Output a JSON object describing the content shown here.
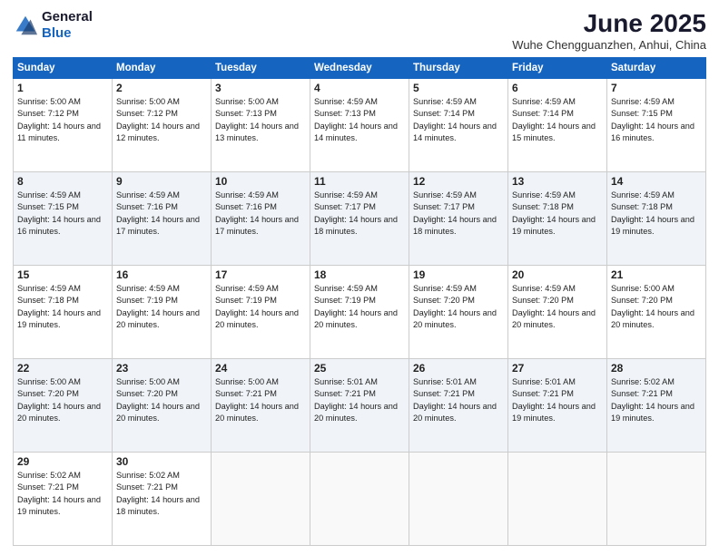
{
  "header": {
    "logo_general": "General",
    "logo_blue": "Blue",
    "month_title": "June 2025",
    "location": "Wuhe Chengguanzhen, Anhui, China"
  },
  "days_of_week": [
    "Sunday",
    "Monday",
    "Tuesday",
    "Wednesday",
    "Thursday",
    "Friday",
    "Saturday"
  ],
  "weeks": [
    [
      {
        "day": "1",
        "sunrise": "Sunrise: 5:00 AM",
        "sunset": "Sunset: 7:12 PM",
        "daylight": "Daylight: 14 hours and 11 minutes."
      },
      {
        "day": "2",
        "sunrise": "Sunrise: 5:00 AM",
        "sunset": "Sunset: 7:12 PM",
        "daylight": "Daylight: 14 hours and 12 minutes."
      },
      {
        "day": "3",
        "sunrise": "Sunrise: 5:00 AM",
        "sunset": "Sunset: 7:13 PM",
        "daylight": "Daylight: 14 hours and 13 minutes."
      },
      {
        "day": "4",
        "sunrise": "Sunrise: 4:59 AM",
        "sunset": "Sunset: 7:13 PM",
        "daylight": "Daylight: 14 hours and 14 minutes."
      },
      {
        "day": "5",
        "sunrise": "Sunrise: 4:59 AM",
        "sunset": "Sunset: 7:14 PM",
        "daylight": "Daylight: 14 hours and 14 minutes."
      },
      {
        "day": "6",
        "sunrise": "Sunrise: 4:59 AM",
        "sunset": "Sunset: 7:14 PM",
        "daylight": "Daylight: 14 hours and 15 minutes."
      },
      {
        "day": "7",
        "sunrise": "Sunrise: 4:59 AM",
        "sunset": "Sunset: 7:15 PM",
        "daylight": "Daylight: 14 hours and 16 minutes."
      }
    ],
    [
      {
        "day": "8",
        "sunrise": "Sunrise: 4:59 AM",
        "sunset": "Sunset: 7:15 PM",
        "daylight": "Daylight: 14 hours and 16 minutes."
      },
      {
        "day": "9",
        "sunrise": "Sunrise: 4:59 AM",
        "sunset": "Sunset: 7:16 PM",
        "daylight": "Daylight: 14 hours and 17 minutes."
      },
      {
        "day": "10",
        "sunrise": "Sunrise: 4:59 AM",
        "sunset": "Sunset: 7:16 PM",
        "daylight": "Daylight: 14 hours and 17 minutes."
      },
      {
        "day": "11",
        "sunrise": "Sunrise: 4:59 AM",
        "sunset": "Sunset: 7:17 PM",
        "daylight": "Daylight: 14 hours and 18 minutes."
      },
      {
        "day": "12",
        "sunrise": "Sunrise: 4:59 AM",
        "sunset": "Sunset: 7:17 PM",
        "daylight": "Daylight: 14 hours and 18 minutes."
      },
      {
        "day": "13",
        "sunrise": "Sunrise: 4:59 AM",
        "sunset": "Sunset: 7:18 PM",
        "daylight": "Daylight: 14 hours and 19 minutes."
      },
      {
        "day": "14",
        "sunrise": "Sunrise: 4:59 AM",
        "sunset": "Sunset: 7:18 PM",
        "daylight": "Daylight: 14 hours and 19 minutes."
      }
    ],
    [
      {
        "day": "15",
        "sunrise": "Sunrise: 4:59 AM",
        "sunset": "Sunset: 7:18 PM",
        "daylight": "Daylight: 14 hours and 19 minutes."
      },
      {
        "day": "16",
        "sunrise": "Sunrise: 4:59 AM",
        "sunset": "Sunset: 7:19 PM",
        "daylight": "Daylight: 14 hours and 20 minutes."
      },
      {
        "day": "17",
        "sunrise": "Sunrise: 4:59 AM",
        "sunset": "Sunset: 7:19 PM",
        "daylight": "Daylight: 14 hours and 20 minutes."
      },
      {
        "day": "18",
        "sunrise": "Sunrise: 4:59 AM",
        "sunset": "Sunset: 7:19 PM",
        "daylight": "Daylight: 14 hours and 20 minutes."
      },
      {
        "day": "19",
        "sunrise": "Sunrise: 4:59 AM",
        "sunset": "Sunset: 7:20 PM",
        "daylight": "Daylight: 14 hours and 20 minutes."
      },
      {
        "day": "20",
        "sunrise": "Sunrise: 4:59 AM",
        "sunset": "Sunset: 7:20 PM",
        "daylight": "Daylight: 14 hours and 20 minutes."
      },
      {
        "day": "21",
        "sunrise": "Sunrise: 5:00 AM",
        "sunset": "Sunset: 7:20 PM",
        "daylight": "Daylight: 14 hours and 20 minutes."
      }
    ],
    [
      {
        "day": "22",
        "sunrise": "Sunrise: 5:00 AM",
        "sunset": "Sunset: 7:20 PM",
        "daylight": "Daylight: 14 hours and 20 minutes."
      },
      {
        "day": "23",
        "sunrise": "Sunrise: 5:00 AM",
        "sunset": "Sunset: 7:20 PM",
        "daylight": "Daylight: 14 hours and 20 minutes."
      },
      {
        "day": "24",
        "sunrise": "Sunrise: 5:00 AM",
        "sunset": "Sunset: 7:21 PM",
        "daylight": "Daylight: 14 hours and 20 minutes."
      },
      {
        "day": "25",
        "sunrise": "Sunrise: 5:01 AM",
        "sunset": "Sunset: 7:21 PM",
        "daylight": "Daylight: 14 hours and 20 minutes."
      },
      {
        "day": "26",
        "sunrise": "Sunrise: 5:01 AM",
        "sunset": "Sunset: 7:21 PM",
        "daylight": "Daylight: 14 hours and 20 minutes."
      },
      {
        "day": "27",
        "sunrise": "Sunrise: 5:01 AM",
        "sunset": "Sunset: 7:21 PM",
        "daylight": "Daylight: 14 hours and 19 minutes."
      },
      {
        "day": "28",
        "sunrise": "Sunrise: 5:02 AM",
        "sunset": "Sunset: 7:21 PM",
        "daylight": "Daylight: 14 hours and 19 minutes."
      }
    ],
    [
      {
        "day": "29",
        "sunrise": "Sunrise: 5:02 AM",
        "sunset": "Sunset: 7:21 PM",
        "daylight": "Daylight: 14 hours and 19 minutes."
      },
      {
        "day": "30",
        "sunrise": "Sunrise: 5:02 AM",
        "sunset": "Sunset: 7:21 PM",
        "daylight": "Daylight: 14 hours and 18 minutes."
      },
      null,
      null,
      null,
      null,
      null
    ]
  ]
}
